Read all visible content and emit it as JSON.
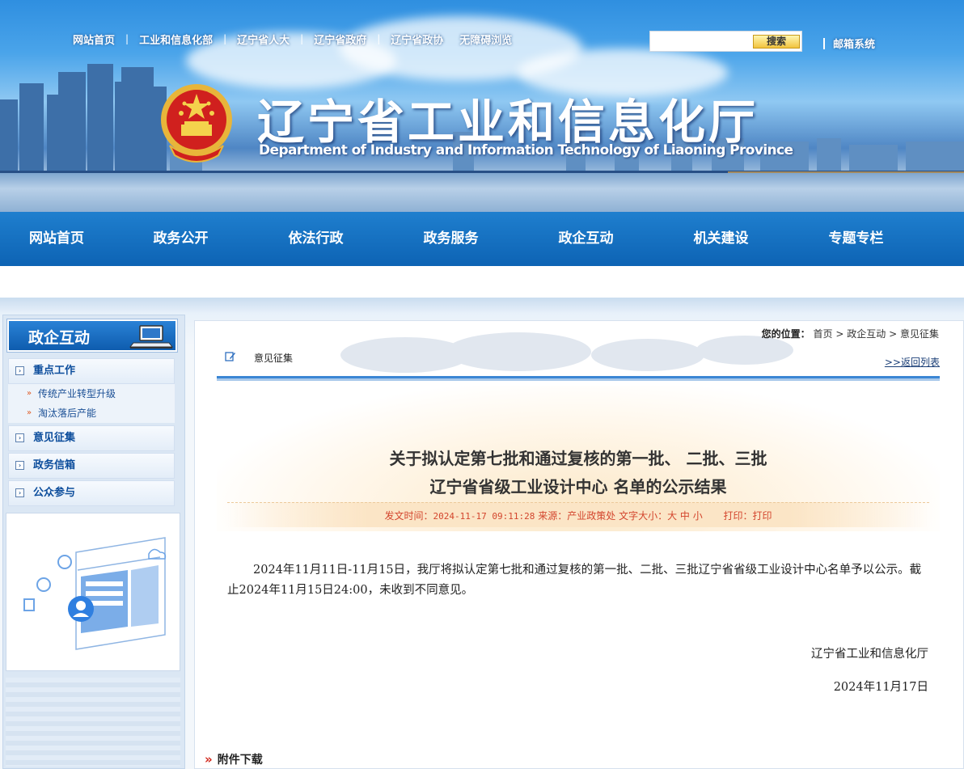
{
  "top_links": [
    "网站首页",
    "工业和信息化部",
    "辽宁省人大",
    "辽宁省政府",
    "辽宁省政协",
    "无障碍浏览"
  ],
  "search": {
    "placeholder": "",
    "button_label": "搜索"
  },
  "mail_link": "邮箱系统",
  "site": {
    "title_cn": "辽宁省工业和信息化厅",
    "title_en": "Department of Industry and Information Technology of Liaoning Province"
  },
  "nav": [
    "网站首页",
    "政务公开",
    "依法行政",
    "政务服务",
    "政企互动",
    "机关建设",
    "专题专栏"
  ],
  "sidebar": {
    "header": "政企互动",
    "categories": [
      {
        "label": "重点工作",
        "subs": [
          "传统产业转型升级",
          "淘汰落后产能"
        ]
      },
      {
        "label": "意见征集"
      },
      {
        "label": "政务信箱"
      },
      {
        "label": "公众参与"
      }
    ]
  },
  "breadcrumb": {
    "label": "您的位置：",
    "items": [
      "首页",
      "政企互动",
      "意见征集"
    ],
    "sep": ">"
  },
  "section": {
    "title": "意见征集",
    "back": ">>返回列表"
  },
  "article": {
    "title_line1": "关于拟认定第七批和通过复核的第一批、  二批、三批",
    "title_line2": "辽宁省省级工业设计中心  名单的公示结果",
    "meta": {
      "time_label": "发文时间：",
      "time": "2024-11-17 09:11:28",
      "source_label": "来源：",
      "source": "产业政策处",
      "size_label": "文字大小：",
      "sizes": [
        "大",
        "中",
        "小"
      ],
      "print_label": "打印：",
      "print": "打印"
    },
    "body": "2024年11月11日-11月15日，我厅将拟认定第七批和通过复核的第一批、二批、三批辽宁省省级工业设计中心名单予以公示。截止2024年11月15日24:00，未收到不同意见。",
    "signature": "辽宁省工业和信息化厅",
    "date": "2024年11月17日"
  },
  "attachments": {
    "label": "附件下载",
    "marker": "»"
  },
  "colors": {
    "nav_bg": "#0d63b4",
    "sidebar_link": "#0c4d9c",
    "meta_text": "#d3452d",
    "attach_marker": "#d2261a"
  }
}
